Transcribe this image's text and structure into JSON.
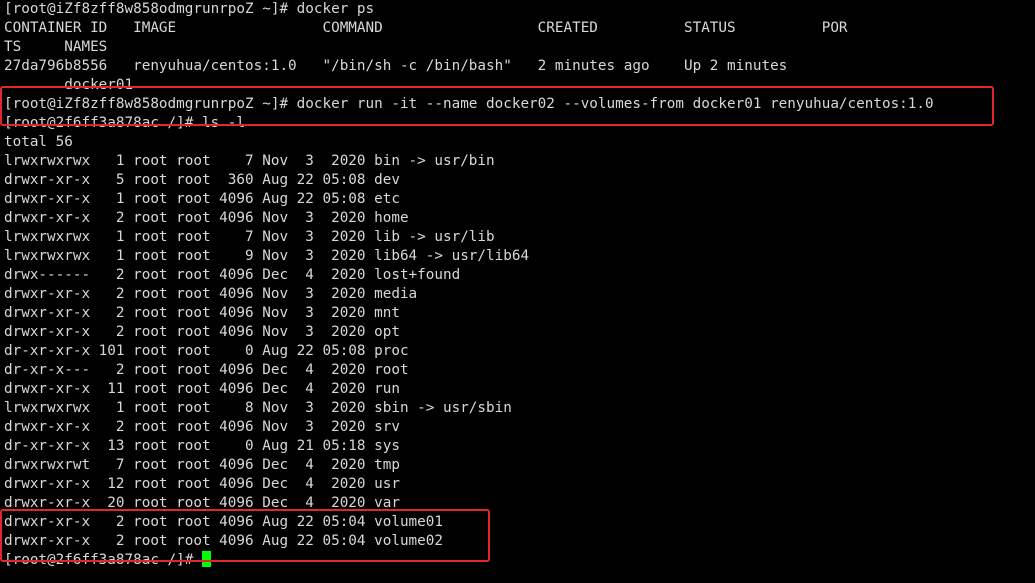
{
  "terminal": {
    "lines": [
      "[root@iZf8zff8w858odmgrunrpoZ ~]# docker ps",
      "CONTAINER ID   IMAGE                 COMMAND                  CREATED          STATUS          POR",
      "TS     NAMES",
      "27da796b8556   renyuhua/centos:1.0   \"/bin/sh -c /bin/bash\"   2 minutes ago    Up 2 minutes",
      "       docker01",
      "[root@iZf8zff8w858odmgrunrpoZ ~]# docker run -it --name docker02 --volumes-from docker01 renyuhua/centos:1.0",
      "[root@2f6ff3a878ac /]# ls -l",
      "total 56",
      "lrwxrwxrwx   1 root root    7 Nov  3  2020 bin -> usr/bin",
      "drwxr-xr-x   5 root root  360 Aug 22 05:08 dev",
      "drwxr-xr-x   1 root root 4096 Aug 22 05:08 etc",
      "drwxr-xr-x   2 root root 4096 Nov  3  2020 home",
      "lrwxrwxrwx   1 root root    7 Nov  3  2020 lib -> usr/lib",
      "lrwxrwxrwx   1 root root    9 Nov  3  2020 lib64 -> usr/lib64",
      "drwx------   2 root root 4096 Dec  4  2020 lost+found",
      "drwxr-xr-x   2 root root 4096 Nov  3  2020 media",
      "drwxr-xr-x   2 root root 4096 Nov  3  2020 mnt",
      "drwxr-xr-x   2 root root 4096 Nov  3  2020 opt",
      "dr-xr-xr-x 101 root root    0 Aug 22 05:08 proc",
      "dr-xr-x---   2 root root 4096 Dec  4  2020 root",
      "drwxr-xr-x  11 root root 4096 Dec  4  2020 run",
      "lrwxrwxrwx   1 root root    8 Nov  3  2020 sbin -> usr/sbin",
      "drwxr-xr-x   2 root root 4096 Nov  3  2020 srv",
      "dr-xr-xr-x  13 root root    0 Aug 21 05:18 sys",
      "drwxrwxrwt   7 root root 4096 Dec  4  2020 tmp",
      "drwxr-xr-x  12 root root 4096 Dec  4  2020 usr",
      "drwxr-xr-x  20 root root 4096 Dec  4  2020 var",
      "drwxr-xr-x   2 root root 4096 Aug 22 05:04 volume01",
      "drwxr-xr-x   2 root root 4096 Aug 22 05:04 volume02"
    ],
    "prompt": "[root@2f6ff3a878ac /]# "
  },
  "colors": {
    "background": "#000000",
    "text": "#d8d8d8",
    "cursor": "#00ff00",
    "highlight_box": "#e0282a"
  }
}
